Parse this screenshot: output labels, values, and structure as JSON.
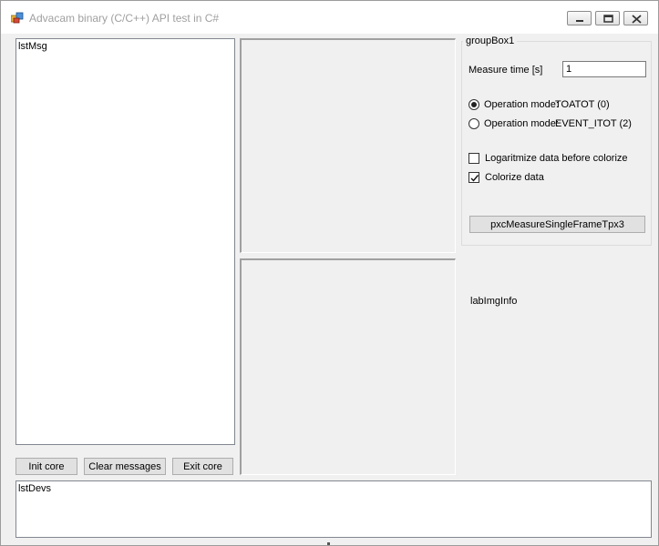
{
  "window": {
    "title": "Advacam binary (C/C++) API test in C#"
  },
  "caption_buttons": {
    "minimize_icon": "minimize-icon",
    "maximize_icon": "restore-icon",
    "close_icon": "close-icon"
  },
  "lists": {
    "messages_label": "lstMsg",
    "devices_label": "lstDevs"
  },
  "buttons": {
    "init_core": "Init core",
    "clear_messages": "Clear messages",
    "exit_core": "Exit core",
    "measure_single_frame": "pxcMeasureSingleFrameTpx3"
  },
  "groupbox": {
    "title": "groupBox1",
    "measure_time_label": "Measure time [s]",
    "measure_time_value": "1",
    "operation_modes": [
      {
        "prefix": "Operation mode:",
        "mode": "TOATOT (0)",
        "selected": true
      },
      {
        "prefix": "Operation mode:",
        "mode": "EVENT_ITOT (2)",
        "selected": false
      }
    ],
    "logarithmize_label": "Logaritmize data before colorize",
    "logarithmize_checked": false,
    "colorize_label": "Colorize data",
    "colorize_checked": true
  },
  "image_info_label": "labImgInfo",
  "colors": {
    "window_bg": "#f0f0f0",
    "title_text": "#a0a0a0",
    "list_bg": "#ffffff"
  }
}
